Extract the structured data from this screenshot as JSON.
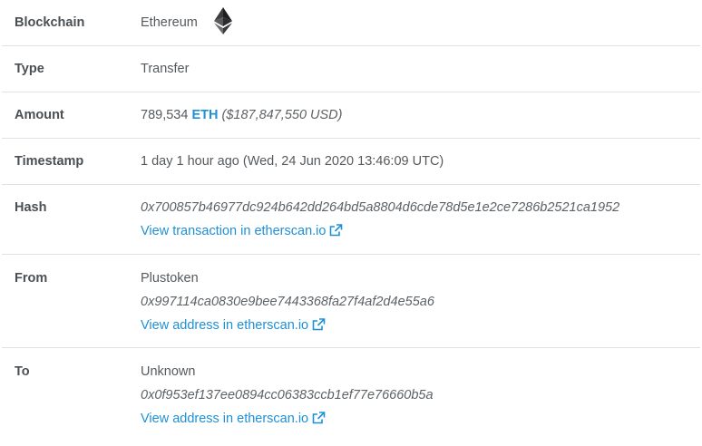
{
  "rows": {
    "blockchain": {
      "label": "Blockchain",
      "value": "Ethereum",
      "icon": "ethereum-logo-icon"
    },
    "type": {
      "label": "Type",
      "value": "Transfer"
    },
    "amount": {
      "label": "Amount",
      "number": "789,534",
      "currency": "ETH",
      "usd": "($187,847,550 USD)"
    },
    "timestamp": {
      "label": "Timestamp",
      "value": "1 day 1 hour ago (Wed, 24 Jun 2020 13:46:09 UTC)"
    },
    "hash": {
      "label": "Hash",
      "value": "0x700857b46977dc924b642dd264bd5a8804d6cde78d5e1e2ce7286b2521ca1952",
      "link": "View transaction in etherscan.io",
      "link_icon": "external-link-icon"
    },
    "from": {
      "label": "From",
      "name": "Plustoken",
      "address": "0x997114ca0830e9bee7443368fa27f4af2d4e55a6",
      "link": "View address in etherscan.io",
      "link_icon": "external-link-icon"
    },
    "to": {
      "label": "To",
      "name": "Unknown",
      "address": "0x0f953ef137ee0894cc06383ccb1ef77e76660b5a",
      "link": "View address in etherscan.io",
      "link_icon": "external-link-icon"
    }
  },
  "colors": {
    "link": "#1e90d6",
    "label": "#4a4f53",
    "text": "#555a5e",
    "divider": "#dfe2e5"
  }
}
